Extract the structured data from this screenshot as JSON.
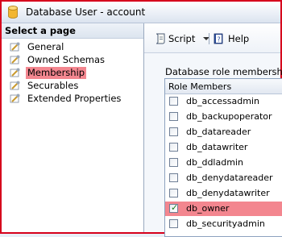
{
  "window": {
    "title": "Database User - account"
  },
  "left_pane": {
    "header": "Select a page",
    "items": [
      {
        "label": "General",
        "selected": false
      },
      {
        "label": "Owned Schemas",
        "selected": false
      },
      {
        "label": "Membership",
        "selected": true
      },
      {
        "label": "Securables",
        "selected": false
      },
      {
        "label": "Extended Properties",
        "selected": false
      }
    ]
  },
  "toolbar": {
    "script_label": "Script",
    "help_label": "Help"
  },
  "membership": {
    "label": "Database role membership:",
    "column_header": "Role Members",
    "roles": [
      {
        "name": "db_accessadmin",
        "checked": false
      },
      {
        "name": "db_backupoperator",
        "checked": false
      },
      {
        "name": "db_datareader",
        "checked": false
      },
      {
        "name": "db_datawriter",
        "checked": false
      },
      {
        "name": "db_ddladmin",
        "checked": false
      },
      {
        "name": "db_denydatareader",
        "checked": false
      },
      {
        "name": "db_denydatawriter",
        "checked": false
      },
      {
        "name": "db_owner",
        "checked": true
      },
      {
        "name": "db_securityadmin",
        "checked": false
      }
    ]
  },
  "colors": {
    "highlight": "#f3868f",
    "frame_border": "#d6001c"
  }
}
